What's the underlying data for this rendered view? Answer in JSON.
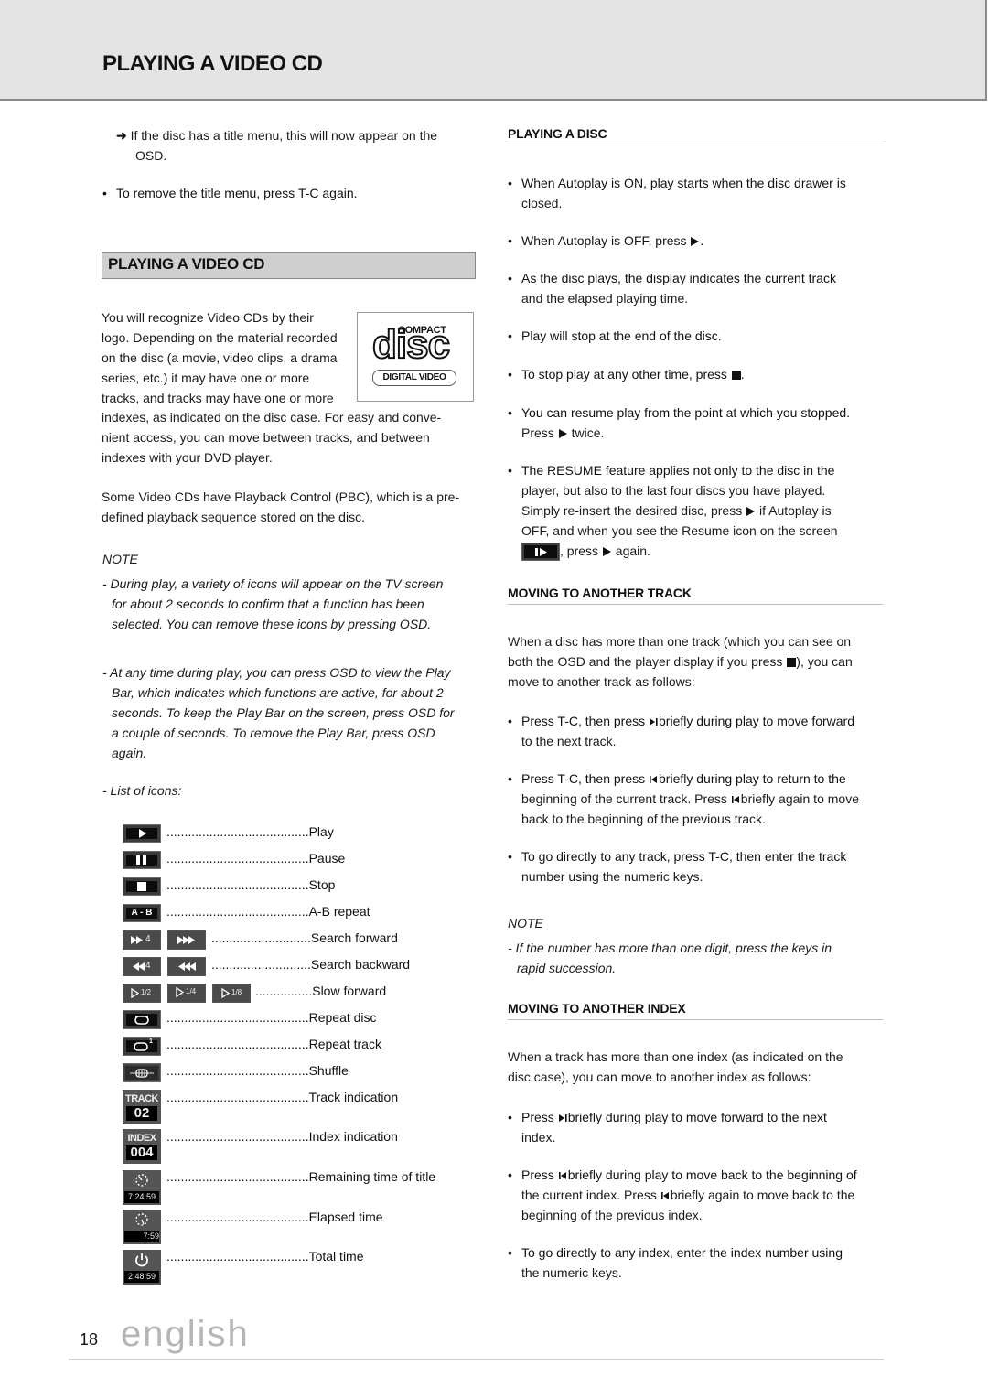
{
  "header": {
    "title": "PLAYING A VIDEO CD"
  },
  "left": {
    "arrow_note": "If the disc has a title menu, this will now appear on the",
    "arrow_note_line2": "OSD.",
    "remove_menu": "To remove the title menu, press T-C again.",
    "section_title": "PLAYING A VIDEO CD",
    "intro_lines": [
      "You will recognize Video CDs by their",
      "logo. Depending on the material recorded",
      "on the disc (a movie, video clips, a drama",
      "series, etc.) it may have one or more",
      "tracks, and tracks may have one or more",
      "indexes, as indicated on the disc case. For easy and conve-",
      "nient access, you can move between tracks, and between",
      "indexes with your DVD player."
    ],
    "pbc_lines": [
      "Some Video CDs have Playback Control (PBC), which is a pre-",
      "defined playback sequence stored on the disc."
    ],
    "note_label": "NOTE",
    "note1_lines": [
      "- During play, a variety of icons will appear on the TV screen",
      "for about 2 seconds to confirm that a function has been",
      "selected. You can remove these icons by pressing OSD."
    ],
    "note2_lines": [
      "- At any time during play, you can press OSD to view the Play",
      "Bar, which indicates which functions are active, for about 2",
      "seconds. To keep the Play Bar on the screen, press OSD for",
      "a couple of seconds. To remove the Play Bar, press OSD",
      "again."
    ],
    "list_label": "- List of icons:",
    "logo": {
      "line1": "COMPACT",
      "line2": "disc",
      "line3": "DIGITAL VIDEO"
    },
    "icons": [
      {
        "icon": "play-icon",
        "dots": "........................................",
        "label": "Play"
      },
      {
        "icon": "pause-icon",
        "dots": "........................................",
        "label": "Pause"
      },
      {
        "icon": "stop-icon",
        "dots": "........................................",
        "label": "Stop"
      },
      {
        "icon": "ab-repeat-icon",
        "glyph": "A - B",
        "dots": "........................................",
        "label": "A-B repeat"
      },
      {
        "icon": "search-forward-icon",
        "glyph": "4",
        "dots": "............................",
        "label": "Search forward"
      },
      {
        "icon": "search-backward-icon",
        "glyph": "4",
        "dots": "............................",
        "label": "Search backward"
      },
      {
        "icon": "slow-forward-icon",
        "glyphs": [
          "1/2",
          "1/4",
          "1/8"
        ],
        "dots": "................",
        "label": "Slow forward"
      },
      {
        "icon": "repeat-disc-icon",
        "dots": "........................................",
        "label": "Repeat disc"
      },
      {
        "icon": "repeat-track-icon",
        "glyph": "1",
        "dots": "........................................",
        "label": "Repeat track"
      },
      {
        "icon": "shuffle-icon",
        "dots": "........................................",
        "label": "Shuffle"
      },
      {
        "icon": "track-indication-icon",
        "glyph_top": "TRACK",
        "glyph_bottom": "02",
        "dots": "........................................",
        "label": "Track indication"
      },
      {
        "icon": "index-indication-icon",
        "glyph_top": "INDEX",
        "glyph_bottom": "004",
        "dots": "........................................",
        "label": "Index indication"
      },
      {
        "icon": "remaining-time-icon",
        "glyph_bottom": "7:24:59",
        "dots": "........................................",
        "label": "Remaining time of title"
      },
      {
        "icon": "elapsed-time-icon",
        "glyph_bottom": "7:59",
        "dots": "........................................",
        "label": "Elapsed time"
      },
      {
        "icon": "total-time-icon",
        "glyph_bottom": "2:48:59",
        "dots": "........................................",
        "label": "Total time"
      }
    ]
  },
  "right": {
    "playing_disc": {
      "title": "PLAYING A DISC",
      "b1": [
        "When Autoplay is ON, play starts when the disc drawer is",
        "closed."
      ],
      "b2_pre": "When Autoplay is OFF, press ",
      "b2_post": ".",
      "b3": [
        "As the disc plays, the display indicates the current track",
        "and the elapsed playing time."
      ],
      "b4": "Play will stop at the end of the disc.",
      "b5_pre": "To stop play at any other time, press ",
      "b5_post": ".",
      "b6_l1": "You can resume play from the point at which you stopped.",
      "b6_l2_pre": "Press ",
      "b6_l2_post": " twice.",
      "b7_l1": "The RESUME feature applies not only to the disc in the",
      "b7_l2": "player, but also to the last four discs you have played.",
      "b7_l3_pre": "Simply re-insert the desired disc, press ",
      "b7_l3_post": " if Autoplay is",
      "b7_l4": "OFF, and when you see the Resume icon on the screen",
      "b7_l5_pre": ", press ",
      "b7_l5_post": " again."
    },
    "moving_track": {
      "title": "MOVING TO ANOTHER TRACK",
      "intro_l1": "When a disc has more than one track (which you can see on",
      "intro_l2_pre": "both the OSD and the player display if you press ",
      "intro_l2_post": "), you can",
      "intro_l3": "move to another track as follows:",
      "b1_l1_pre": "Press T-C, then press ",
      "b1_l1_post": "briefly during play to move forward",
      "b1_l2": "to the next track.",
      "b2_l1_pre": "Press T-C, then press ",
      "b2_l1_post": "briefly during play to return to the",
      "b2_l2_pre": "beginning of the current track. Press ",
      "b2_l2_post": "briefly again to move",
      "b2_l3": "back to the beginning of the previous track.",
      "b3": [
        "To go directly to any track, press T-C, then enter the track",
        "number using the numeric keys."
      ],
      "note_label": "NOTE",
      "note": [
        "- If the number has more than one digit, press the keys in",
        "rapid succession."
      ]
    },
    "moving_index": {
      "title": "MOVING TO ANOTHER INDEX",
      "intro": [
        "When a track has more than one index (as indicated on the",
        "disc case), you can move to another index as follows:"
      ],
      "b1_l1_pre": "Press ",
      "b1_l1_post": "briefly during play to move forward to the next",
      "b1_l2": "index.",
      "b2_l1_pre": "Press ",
      "b2_l1_post": "briefly during play to move back to the beginning of",
      "b2_l2_pre": "the current index. Press ",
      "b2_l2_post": "briefly again to move back to the",
      "b2_l3": "beginning of the previous index.",
      "b3": [
        "To go directly to any index, enter the index number using",
        "the numeric keys."
      ]
    }
  },
  "footer": {
    "page_number": "18",
    "language": "english"
  },
  "bullet_char": "•",
  "arrow_char": "➜"
}
